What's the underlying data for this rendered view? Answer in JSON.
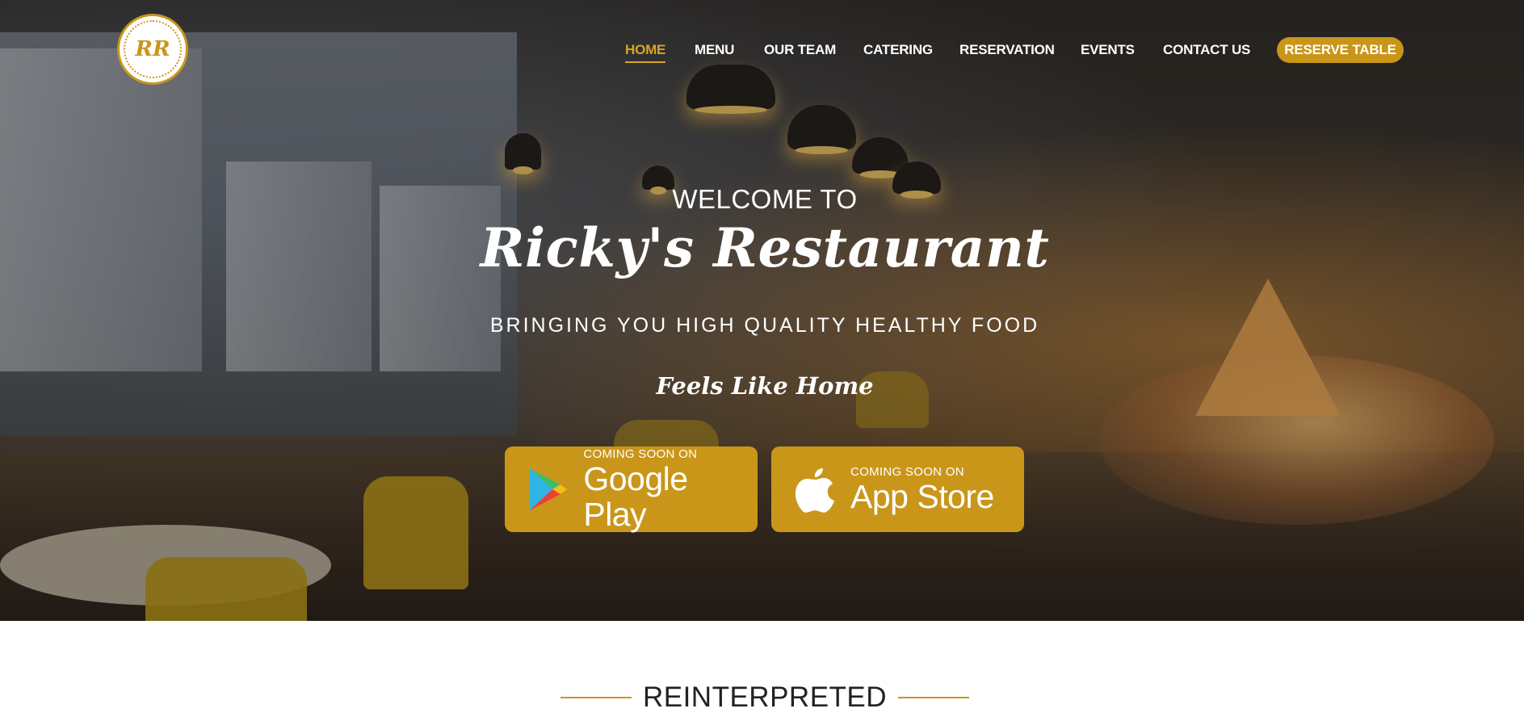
{
  "nav": {
    "logo_alt": "RR",
    "items": [
      {
        "label": "HOME",
        "active": true
      },
      {
        "label": "MENU",
        "active": false
      },
      {
        "label": "OUR TEAM",
        "active": false
      },
      {
        "label": "CATERING",
        "active": false
      },
      {
        "label": "RESERVATION",
        "active": false
      },
      {
        "label": "EVENTS",
        "active": false
      },
      {
        "label": "CONTACT US",
        "active": false
      }
    ],
    "cta_label": "RESERVE TABLE"
  },
  "hero": {
    "welcome": "WELCOME TO",
    "brand": "Ricky's Restaurant",
    "tagline": "BRINGING YOU HIGH QUALITY HEALTHY FOOD",
    "slogan": "Feels Like Home"
  },
  "stores": [
    {
      "small": "COMING SOON ON",
      "big": "Google Play",
      "icon": "google-play-icon"
    },
    {
      "small": "COMING SOON ON",
      "big": "App Store",
      "icon": "apple-icon"
    }
  ],
  "section": {
    "title": "REINTERPRETED"
  },
  "colors": {
    "accent": "#c9961a",
    "active_nav": "#d8a623",
    "text_light": "#ffffff",
    "heading_dark": "#222222"
  }
}
